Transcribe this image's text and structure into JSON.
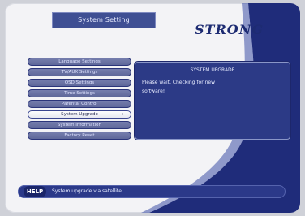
{
  "screen": {
    "title": "System Setting",
    "logo_text": "STRONG"
  },
  "menu": {
    "items": [
      {
        "label": "Language Settings"
      },
      {
        "label": "TV/AUX Settings"
      },
      {
        "label": "OSD Settings"
      },
      {
        "label": "Time Settings"
      },
      {
        "label": "Parental Control"
      },
      {
        "label": "System Upgrade",
        "selected": true
      },
      {
        "label": "System Information"
      },
      {
        "label": "Factory Reset"
      }
    ],
    "selected_arrow": "▸"
  },
  "panel": {
    "title": "SYSTEM UPGRADE",
    "message": "Please wait, Checking for new software!"
  },
  "help": {
    "badge": "HELP",
    "text": "System upgrade via satellite"
  },
  "colors": {
    "panel_bg": "#2c3a86",
    "menu_bg": "#5f699c",
    "selected_bg": "#f2f3f8",
    "swoosh": "#1f2c7a"
  },
  "icons": {
    "selected_item_arrow": "arrow-right-icon"
  }
}
